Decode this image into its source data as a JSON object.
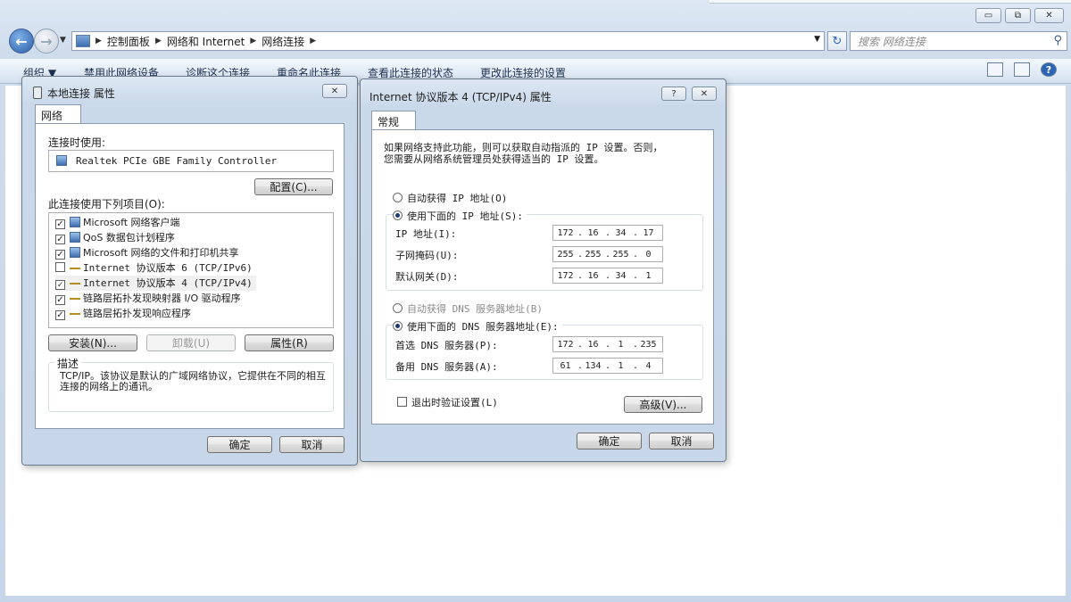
{
  "explorer": {
    "breadcrumbs": [
      "控制面板",
      "网络和 Internet",
      "网络连接"
    ],
    "search_placeholder": "搜索 网络连接",
    "toolbar": [
      "组织 ▼",
      "禁用此网络设备",
      "诊断这个连接",
      "重命名此连接",
      "查看此连接的状态",
      "更改此连接的设置"
    ],
    "caption": {
      "minimize": "▭",
      "maximize": "⧉",
      "close": "✕"
    }
  },
  "props_dialog": {
    "title": "本地连接 属性",
    "close": "✕",
    "tab": "网络",
    "connect_using_label": "连接时使用:",
    "adapter": "Realtek PCIe GBE Family Controller",
    "configure_button": "配置(C)...",
    "items_label": "此连接使用下列项目(O):",
    "items": [
      {
        "label": "Microsoft 网络客户端",
        "checked": true,
        "icon": "network-client-icon"
      },
      {
        "label": "QoS 数据包计划程序",
        "checked": true,
        "icon": "qos-icon"
      },
      {
        "label": "Microsoft 网络的文件和打印机共享",
        "checked": true,
        "icon": "file-share-icon"
      },
      {
        "label": "Internet 协议版本 6 (TCP/IPv6)",
        "checked": false,
        "icon": "protocol-icon"
      },
      {
        "label": "Internet 协议版本 4 (TCP/IPv4)",
        "checked": true,
        "icon": "protocol-icon"
      },
      {
        "label": "链路层拓扑发现映射器 I/O 驱动程序",
        "checked": true,
        "icon": "protocol-icon"
      },
      {
        "label": "链路层拓扑发现响应程序",
        "checked": true,
        "icon": "protocol-icon"
      }
    ],
    "install_button": "安装(N)...",
    "uninstall_button": "卸载(U)",
    "properties_button": "属性(R)",
    "description_label": "描述",
    "description": "TCP/IP。该协议是默认的广域网络协议，它提供在不同的相互连接的网络上的通讯。",
    "ok_button": "确定",
    "cancel_button": "取消"
  },
  "ipv4_dialog": {
    "title": "Internet 协议版本 4 (TCP/IPv4) 属性",
    "help": "?",
    "close": "✕",
    "tab": "常规",
    "intro_line1": "如果网络支持此功能，则可以获取自动指派的 IP 设置。否则，",
    "intro_line2": "您需要从网络系统管理员处获得适当的 IP 设置。",
    "auto_ip_label": "自动获得 IP 地址(O)",
    "manual_ip_label": "使用下面的 IP 地址(S):",
    "ip_label": "IP 地址(I):",
    "ip": [
      "172",
      "16",
      "34",
      "17"
    ],
    "mask_label": "子网掩码(U):",
    "mask": [
      "255",
      "255",
      "255",
      "0"
    ],
    "gateway_label": "默认网关(D):",
    "gateway": [
      "172",
      "16",
      "34",
      "1"
    ],
    "auto_dns_label": "自动获得 DNS 服务器地址(B)",
    "manual_dns_label": "使用下面的 DNS 服务器地址(E):",
    "dns1_label": "首选 DNS 服务器(P):",
    "dns1": [
      "172",
      "16",
      "1",
      "235"
    ],
    "dns2_label": "备用 DNS 服务器(A):",
    "dns2": [
      "61",
      "134",
      "1",
      "4"
    ],
    "validate_label": "退出时验证设置(L)",
    "advanced_button": "高级(V)...",
    "ok_button": "确定",
    "cancel_button": "取消"
  }
}
